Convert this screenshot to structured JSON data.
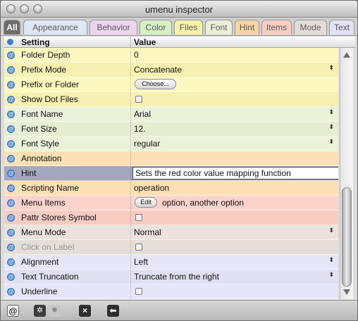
{
  "window": {
    "title": "umenu inspector"
  },
  "tabs": [
    {
      "label": "All",
      "active": true,
      "color": "#6d6d6d"
    },
    {
      "label": "Appearance",
      "color": "#dfe7f4"
    },
    {
      "label": "Behavior",
      "color": "#ecd6ee"
    },
    {
      "label": "Color",
      "color": "#d6f0c4"
    },
    {
      "label": "Files",
      "color": "#f6f2a8"
    },
    {
      "label": "Font",
      "color": "#ebf0d8"
    },
    {
      "label": "Hint",
      "color": "#f7d4a4"
    },
    {
      "label": "Items",
      "color": "#f9cdc4"
    },
    {
      "label": "Mode",
      "color": "#e4dcd7"
    },
    {
      "label": "Text",
      "color": "#e3e2f6"
    }
  ],
  "table": {
    "headers": {
      "setting": "Setting",
      "value": "Value"
    },
    "rows": [
      {
        "setting": "Folder Depth",
        "value": "0",
        "bg": "#fdf8c0"
      },
      {
        "setting": "Prefix Mode",
        "value": "Concatenate",
        "bg": "#f6f0b2",
        "popup": true
      },
      {
        "setting": "Prefix or Folder",
        "button": "Choose...",
        "bg": "#fdf8c0"
      },
      {
        "setting": "Show Dot Files",
        "checkbox": true,
        "bg": "#f6f0b2"
      },
      {
        "setting": "Font Name",
        "value": "Arial",
        "bg": "#ecf2da",
        "popup": true
      },
      {
        "setting": "Font Size",
        "value": "12.",
        "bg": "#e6edd2",
        "popup": true
      },
      {
        "setting": "Font Style",
        "value": "regular",
        "bg": "#ecf2da",
        "popup": true
      },
      {
        "setting": "Annotation",
        "value": "",
        "bg": "#fde0b6"
      },
      {
        "setting": "Hint",
        "value": "Sets the red color value mapping function",
        "selected": true,
        "editing": true,
        "bg": "#a4a7be"
      },
      {
        "setting": "Scripting Name",
        "value": "operation",
        "bg": "#fde0b6"
      },
      {
        "setting": "Menu Items",
        "button": "Edit",
        "value": "option, another option",
        "bg": "#fbd3cb"
      },
      {
        "setting": "Pattr Stores Symbol",
        "checkbox": true,
        "bg": "#f6ccc3"
      },
      {
        "setting": "Menu Mode",
        "value": "Normal",
        "bg": "#ebe3de",
        "popup": true
      },
      {
        "setting": "Click on Label",
        "checkbox": true,
        "bg": "#e5ddd8",
        "disabled": true
      },
      {
        "setting": "Alignment",
        "value": "Left",
        "bg": "#e7e6f8",
        "popup": true
      },
      {
        "setting": "Text Truncation",
        "value": "Truncate from the right",
        "bg": "#e1e0f3",
        "popup": true
      },
      {
        "setting": "Underline",
        "checkbox": true,
        "bg": "#e7e6f8"
      }
    ]
  },
  "scrollbar": {
    "position": "bottom"
  },
  "toolbar": {
    "buttons": [
      {
        "name": "attribute-at-icon",
        "glyph": "@"
      },
      {
        "name": "snowflake-icon",
        "glyph": "✲"
      },
      {
        "name": "gear-icon",
        "glyph": "✹"
      },
      {
        "name": "close-icon",
        "glyph": "×"
      },
      {
        "name": "back-arrow-icon",
        "glyph": "⬅"
      }
    ]
  },
  "icons": {
    "row_marker": "@",
    "popup_arrows": "⬍"
  }
}
